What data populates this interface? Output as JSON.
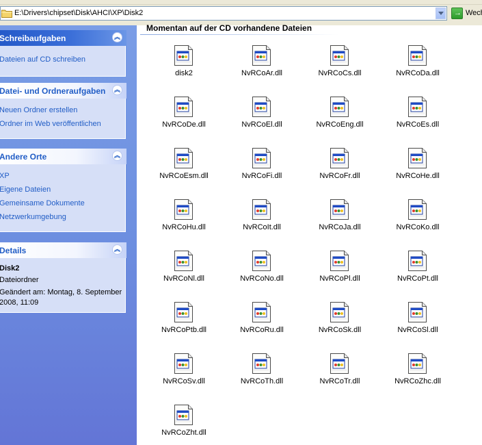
{
  "address": {
    "path": "E:\\Drivers\\chipset\\Disk\\AHCI\\XP\\Disk2",
    "go_label": "Wech"
  },
  "task_groups": [
    {
      "title": "Schreibaufgaben",
      "items": [
        "Dateien auf CD schreiben"
      ]
    },
    {
      "title": "Datei- und Ordneraufgaben",
      "items": [
        "Neuen Ordner erstellen",
        "Ordner im Web veröffentlichen"
      ]
    },
    {
      "title": "Andere Orte",
      "items": [
        "XP",
        "Eigene Dateien",
        "Gemeinsame Dokumente",
        "Netzwerkumgebung"
      ]
    },
    {
      "title": "Details",
      "name": "Disk2",
      "type": "Dateiordner",
      "modified": "Geändert am: Montag, 8. September",
      "modified_time": "2008, 11:09"
    }
  ],
  "content": {
    "section_title": "Momentan auf der CD vorhandene Dateien",
    "files": [
      "disk2",
      "NvRCoAr.dll",
      "NvRCoCs.dll",
      "NvRCoDa.dll",
      "NvRCoDe.dll",
      "NvRCoEl.dll",
      "NvRCoEng.dll",
      "NvRCoEs.dll",
      "NvRCoEsm.dll",
      "NvRCoFi.dll",
      "NvRCoFr.dll",
      "NvRCoHe.dll",
      "NvRCoHu.dll",
      "NvRCoIt.dll",
      "NvRCoJa.dll",
      "NvRCoKo.dll",
      "NvRCoNl.dll",
      "NvRCoNo.dll",
      "NvRCoPl.dll",
      "NvRCoPt.dll",
      "NvRCoPtb.dll",
      "NvRCoRu.dll",
      "NvRCoSk.dll",
      "NvRCoSl.dll",
      "NvRCoSv.dll",
      "NvRCoTh.dll",
      "NvRCoTr.dll",
      "NvRCoZhc.dll",
      "NvRCoZht.dll"
    ]
  },
  "icons": {
    "file": "dll-file-icon",
    "collapse": "chevron-up-icon",
    "go": "go-arrow-icon",
    "folder": "folder-icon"
  }
}
